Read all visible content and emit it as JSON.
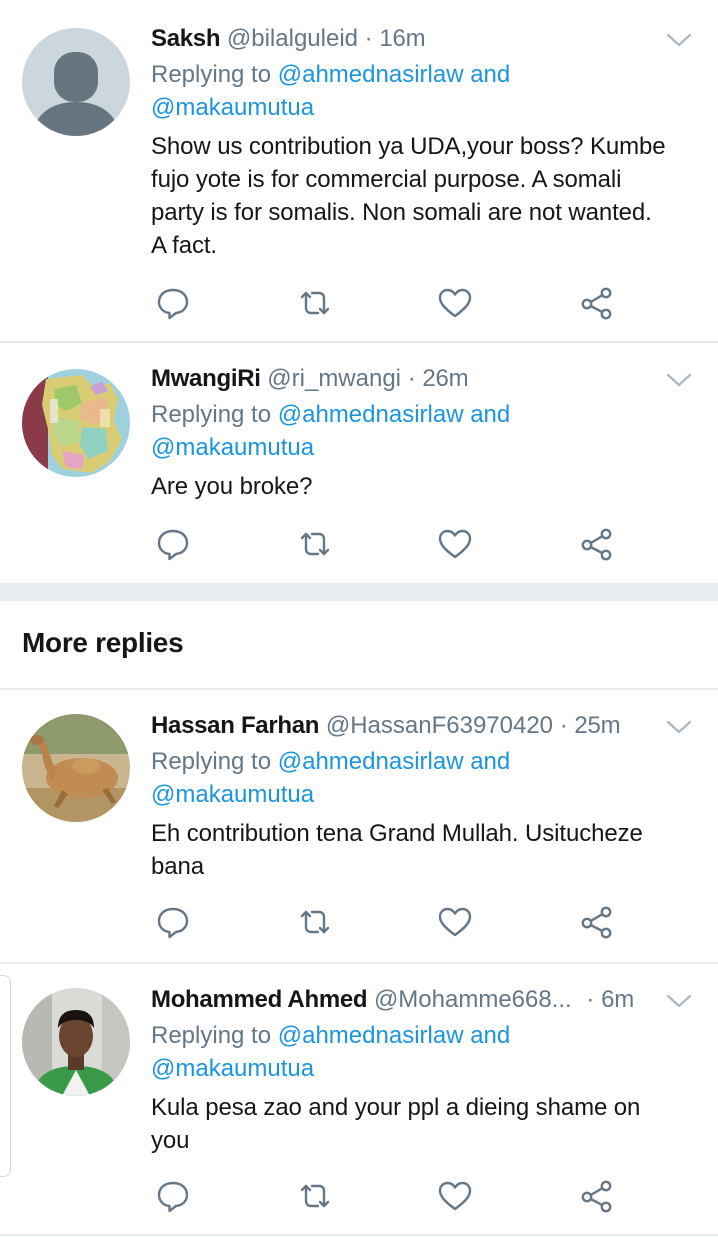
{
  "tweets": [
    {
      "name": "Saksh",
      "handle": "@bilalguleid",
      "separator": "·",
      "time": "16m",
      "replying_prefix": "Replying to",
      "mention1": "@ahmednasirlaw and",
      "mention2": "@makaumutua",
      "text_lines": [
        "Show us contribution ya UDA,your boss?  Kumbe",
        "fujo yote is for commercial purpose. A somali",
        "party is for somalis. Non somali are not wanted.",
        "A fact."
      ],
      "avatar": "default-avatar"
    },
    {
      "name": "MwangiRi",
      "handle": "@ri_mwangi",
      "separator": "·",
      "time": "26m",
      "replying_prefix": "Replying to",
      "mention1": "@ahmednasirlaw and",
      "mention2": "@makaumutua",
      "text_lines": [
        "Are you broke?"
      ],
      "avatar": "map-avatar"
    },
    {
      "name": "Hassan Farhan",
      "handle": "@HassanF63970420",
      "separator": "·",
      "time": "25m",
      "replying_prefix": "Replying to",
      "mention1": "@ahmednasirlaw and",
      "mention2": "@makaumutua",
      "text_lines": [
        "Eh contribution tena Grand Mullah. Usitucheze",
        "bana"
      ],
      "avatar": "camel-avatar"
    },
    {
      "name": "Mohammed Ahmed",
      "handle": "@Mohamme668...",
      "separator": "·",
      "time": "6m",
      "replying_prefix": "Replying to",
      "mention1": "@ahmednasirlaw and",
      "mention2": "@makaumutua",
      "text_lines": [
        "Kula pesa zao and your ppl a dieing shame on",
        "you"
      ],
      "avatar": "photo-avatar"
    }
  ],
  "section": {
    "more_replies": "More replies"
  },
  "icons": {
    "reply": "reply-icon",
    "retweet": "retweet-icon",
    "like": "like-icon",
    "share": "share-icon",
    "menu": "chevron-down-icon"
  },
  "colors": {
    "link": "#1b95e0",
    "secondary_text": "#657786",
    "primary_text": "#14171a",
    "divider": "#e6ecf0"
  }
}
